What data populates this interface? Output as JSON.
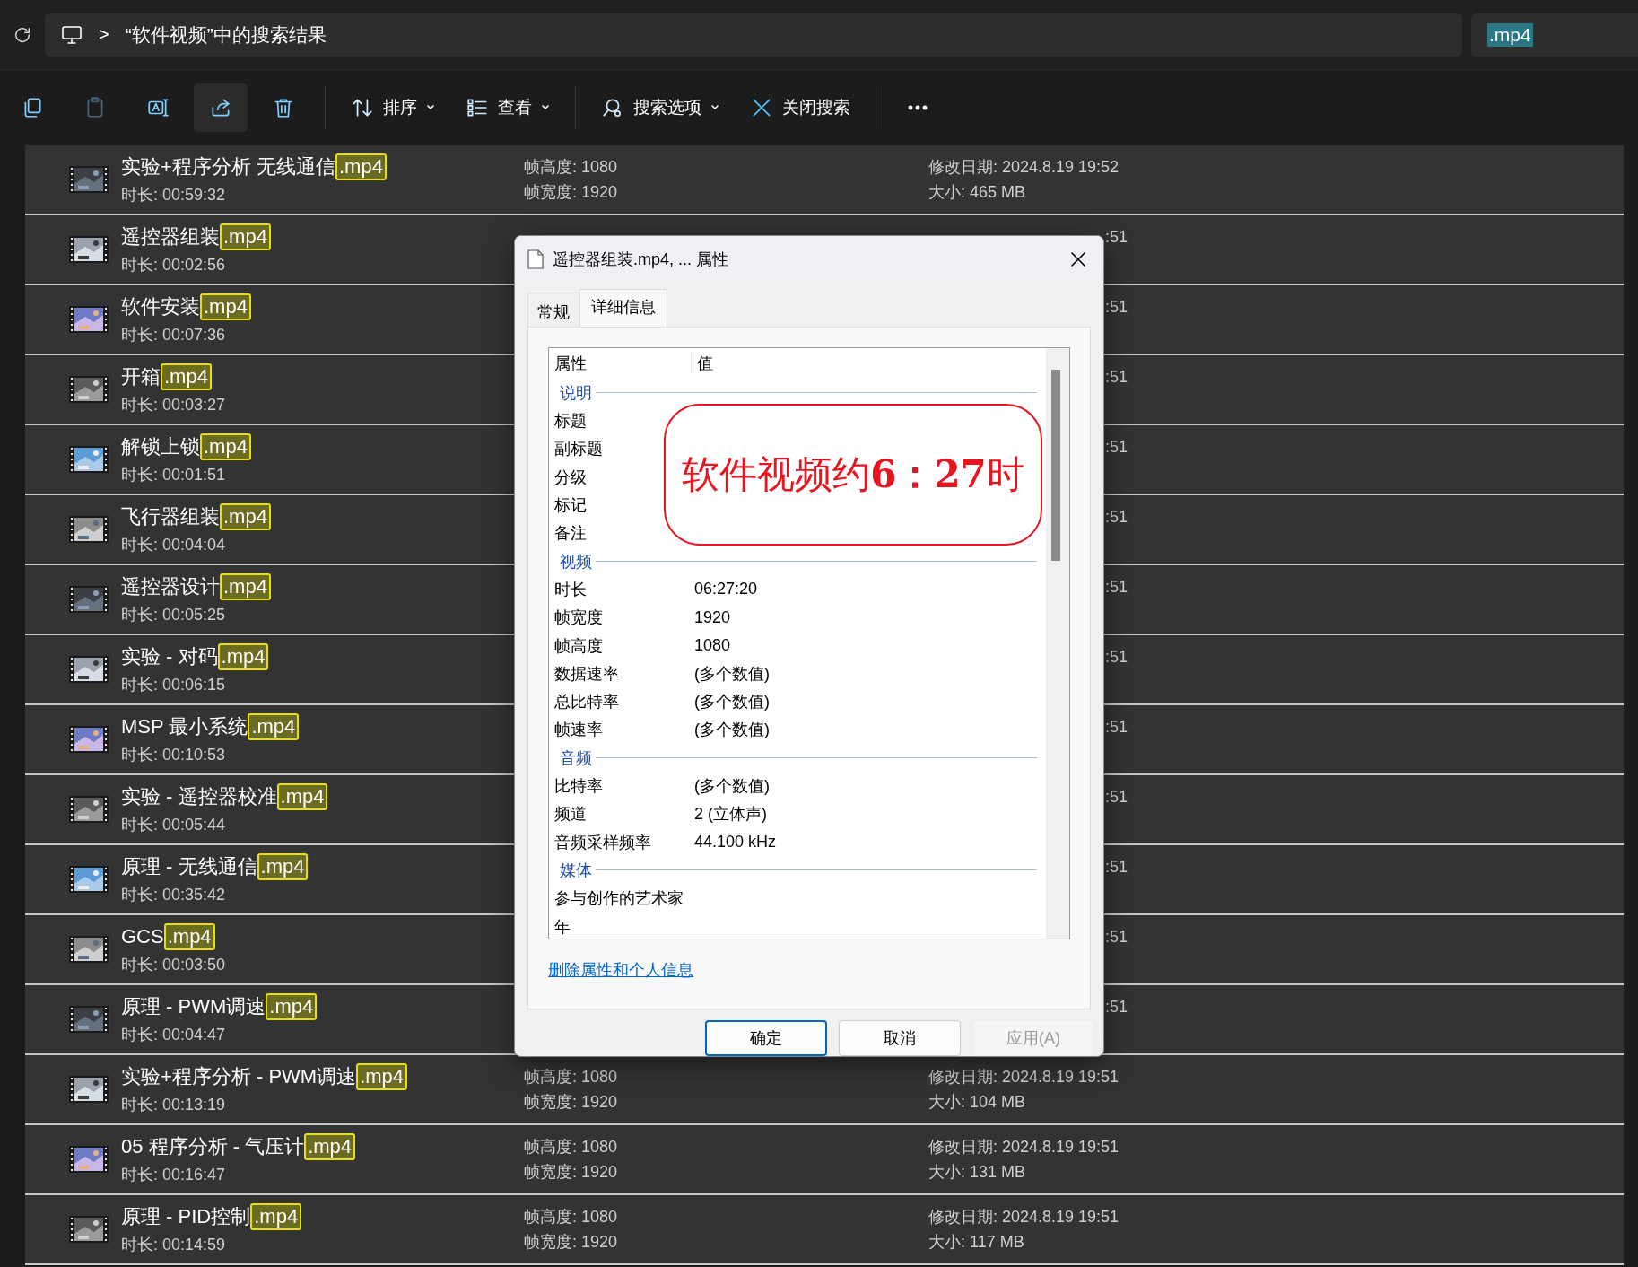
{
  "address_bar": {
    "separator": ">",
    "path": "“软件视频”中的搜索结果"
  },
  "search": {
    "value": ".mp4",
    "selected": true
  },
  "toolbar": [
    {
      "kind": "icon",
      "disabled": false
    },
    {
      "kind": "icon",
      "disabled": true
    },
    {
      "kind": "icon",
      "disabled": false
    },
    {
      "kind": "icon",
      "disabled": false
    },
    {
      "kind": "icon",
      "disabled": false
    },
    {
      "kind": "divider"
    },
    {
      "kind": "menu",
      "label": "排序"
    },
    {
      "kind": "menu",
      "label": "查看"
    },
    {
      "kind": "divider"
    },
    {
      "kind": "menu",
      "label": "搜索选项"
    },
    {
      "kind": "action",
      "label": "关闭搜索"
    },
    {
      "kind": "divider"
    },
    {
      "kind": "icon",
      "disabled": false
    }
  ],
  "files": [
    {
      "name": "实验+程序分析 无线通信",
      "ext": ".mp4",
      "duration": "时长: 00:59:32",
      "frame_height": "帧高度: 1080",
      "frame_width": "帧宽度: 1920",
      "modified": "修改日期: 2024.8.19 19:52",
      "size": "大小: 465 MB"
    },
    {
      "name": "遥控器组装",
      "ext": ".mp4",
      "duration": "时长: 00:02:56",
      "modified_fragment": ":51"
    },
    {
      "name": "软件安装",
      "ext": ".mp4",
      "duration": "时长: 00:07:36",
      "modified_fragment": ":51"
    },
    {
      "name": "开箱",
      "ext": ".mp4",
      "duration": "时长: 00:03:27",
      "modified_fragment": ":51"
    },
    {
      "name": "解锁上锁",
      "ext": ".mp4",
      "duration": "时长: 00:01:51",
      "modified_fragment": ":51"
    },
    {
      "name": "飞行器组装",
      "ext": ".mp4",
      "duration": "时长: 00:04:04",
      "modified_fragment": ":51"
    },
    {
      "name": "遥控器设计",
      "ext": ".mp4",
      "duration": "时长: 00:05:25",
      "modified_fragment": ":51"
    },
    {
      "name": "实验 - 对码",
      "ext": ".mp4",
      "duration": "时长: 00:06:15",
      "modified_fragment": ":51"
    },
    {
      "name": "MSP 最小系统",
      "ext": ".mp4",
      "duration": "时长: 00:10:53",
      "modified_fragment": ":51"
    },
    {
      "name": "实验 - 遥控器校准",
      "ext": ".mp4",
      "duration": "时长: 00:05:44",
      "modified_fragment": ":51"
    },
    {
      "name": "原理 - 无线通信",
      "ext": ".mp4",
      "duration": "时长: 00:35:42",
      "modified_fragment": ":51"
    },
    {
      "name": "GCS",
      "ext": ".mp4",
      "duration": "时长: 00:03:50",
      "modified_fragment": ":51"
    },
    {
      "name": "原理 - PWM调速",
      "ext": ".mp4",
      "duration": "时长: 00:04:47",
      "modified_fragment": ":51"
    },
    {
      "name": "实验+程序分析 - PWM调速",
      "ext": ".mp4",
      "duration": "时长: 00:13:19",
      "frame_height": "帧高度: 1080",
      "frame_width": "帧宽度: 1920",
      "modified": "修改日期: 2024.8.19 19:51",
      "size": "大小: 104 MB"
    },
    {
      "name": "05 程序分析 - 气压计",
      "ext": ".mp4",
      "duration": "时长: 00:16:47",
      "frame_height": "帧高度: 1080",
      "frame_width": "帧宽度: 1920",
      "modified": "修改日期: 2024.8.19 19:51",
      "size": "大小: 131 MB"
    },
    {
      "name": "原理 - PID控制",
      "ext": ".mp4",
      "duration": "时长: 00:14:59",
      "frame_height": "帧高度: 1080",
      "frame_width": "帧宽度: 1920",
      "modified": "修改日期: 2024.8.19 19:51",
      "size": "大小: 117 MB"
    }
  ],
  "dialog": {
    "title": "遥控器组装.mp4, ... 属性",
    "tabs": [
      {
        "label": "常规",
        "selected": false
      },
      {
        "label": "详细信息",
        "selected": true
      }
    ],
    "columns": [
      "属性",
      "值"
    ],
    "properties": [
      {
        "kind": "group",
        "label": "说明"
      },
      {
        "kind": "prop",
        "label": "标题"
      },
      {
        "kind": "prop",
        "label": "副标题"
      },
      {
        "kind": "prop",
        "label": "分级"
      },
      {
        "kind": "prop",
        "label": "标记"
      },
      {
        "kind": "prop",
        "label": "备注"
      },
      {
        "kind": "group",
        "label": "视频"
      },
      {
        "kind": "prop",
        "label": "时长",
        "value": "06:27:20"
      },
      {
        "kind": "prop",
        "label": "帧宽度",
        "value": "1920"
      },
      {
        "kind": "prop",
        "label": "帧高度",
        "value": "1080"
      },
      {
        "kind": "prop",
        "label": "数据速率",
        "value": "(多个数值)"
      },
      {
        "kind": "prop",
        "label": "总比特率",
        "value": "(多个数值)"
      },
      {
        "kind": "prop",
        "label": "帧速率",
        "value": "(多个数值)"
      },
      {
        "kind": "group",
        "label": "音频"
      },
      {
        "kind": "prop",
        "label": "比特率",
        "value": "(多个数值)"
      },
      {
        "kind": "prop",
        "label": "频道",
        "value": "2 (立体声)"
      },
      {
        "kind": "prop",
        "label": "音频采样频率",
        "value": "44.100 kHz"
      },
      {
        "kind": "group",
        "label": "媒体"
      },
      {
        "kind": "prop",
        "label": "参与创作的艺术家"
      },
      {
        "kind": "prop",
        "label": "年"
      }
    ],
    "annotation": "软件视频约**6：27**时",
    "link": "删除属性和个人信息",
    "buttons": [
      {
        "label": "确定",
        "default": true,
        "disabled": false
      },
      {
        "label": "取消",
        "default": false,
        "disabled": false
      },
      {
        "label": "应用(A)",
        "default": false,
        "disabled": true
      }
    ]
  }
}
